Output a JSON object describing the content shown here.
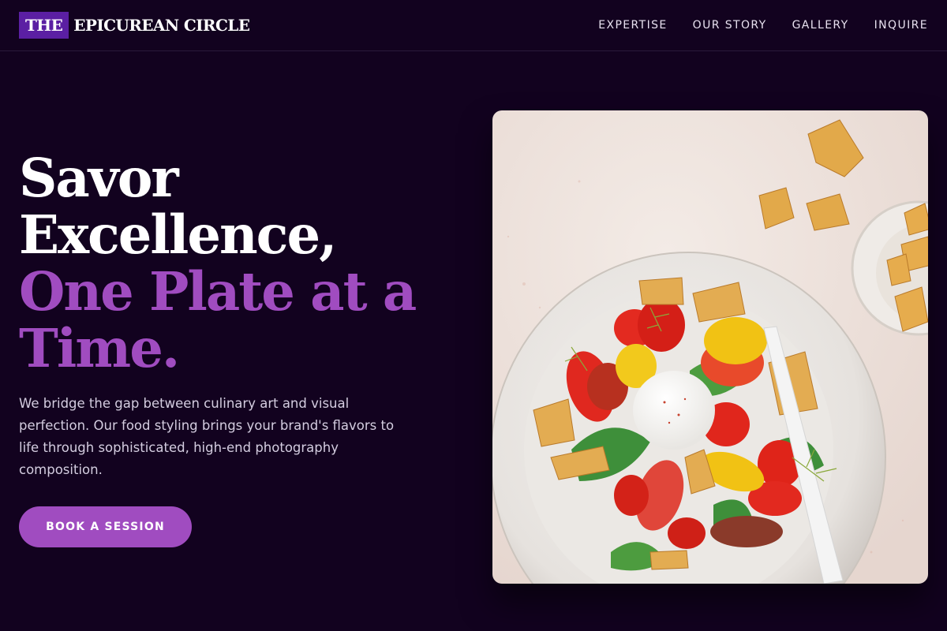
{
  "brand": {
    "mark": "THE",
    "name": "EPICUREAN CIRCLE"
  },
  "nav": {
    "items": [
      {
        "label": "EXPERTISE"
      },
      {
        "label": "OUR STORY"
      },
      {
        "label": "GALLERY"
      },
      {
        "label": "INQUIRE"
      }
    ]
  },
  "hero": {
    "title_line1": "Savor",
    "title_line2": "Excellence,",
    "title_accent_line1": "One Plate at a",
    "title_accent_line2": "Time.",
    "description": "We bridge the gap between culinary art and visual perfection. Our food styling brings your brand's flavors to life through sophisticated, high-end photography composition.",
    "cta_label": "BOOK A SESSION"
  },
  "colors": {
    "background": "#12021f",
    "accent": "#a04cc0",
    "logo_mark": "#5b1fa3"
  }
}
